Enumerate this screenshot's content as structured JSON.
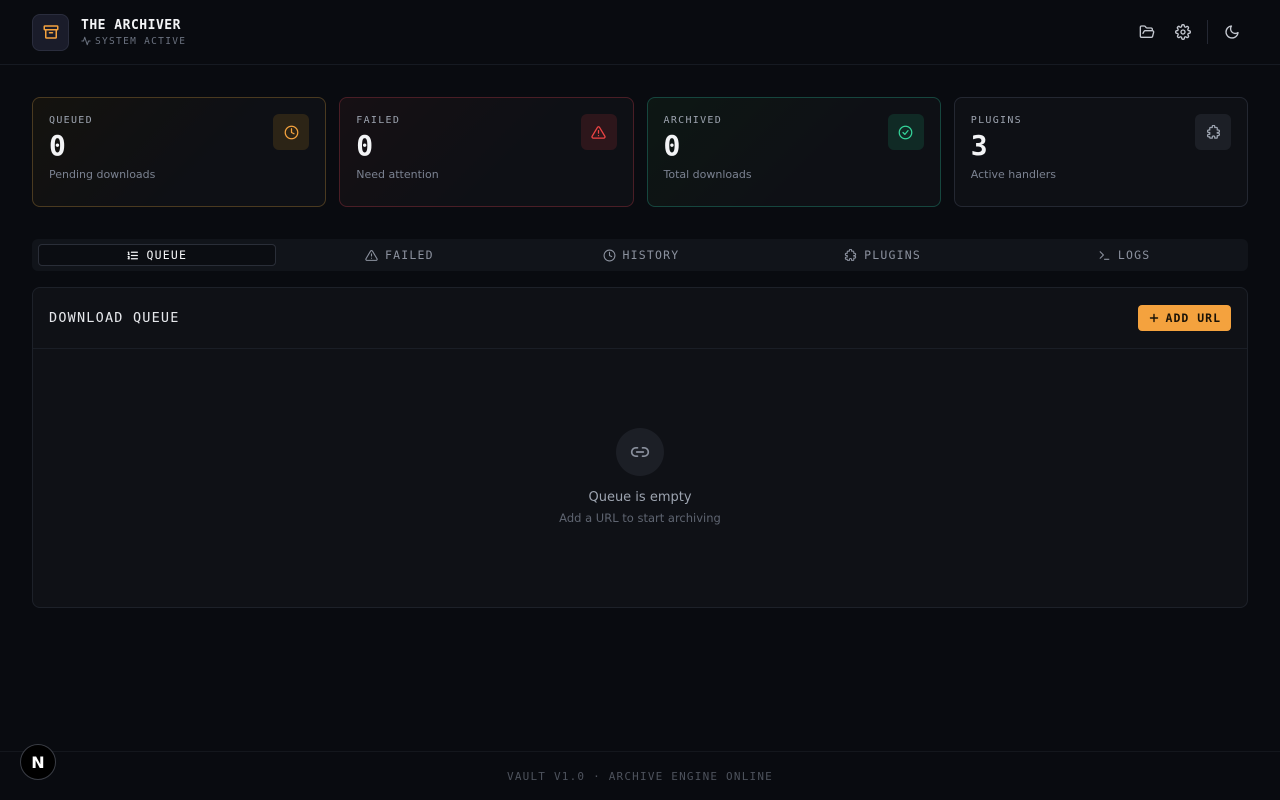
{
  "header": {
    "title": "THE ARCHIVER",
    "status": "SYSTEM ACTIVE",
    "actions": [
      "folder-open-icon",
      "gear-icon",
      "moon-icon"
    ]
  },
  "stats": [
    {
      "label": "QUEUED",
      "value": "0",
      "sub": "Pending downloads",
      "icon": "clock-icon",
      "color": "#f4a23e"
    },
    {
      "label": "FAILED",
      "value": "0",
      "sub": "Need attention",
      "icon": "warning-icon",
      "color": "#ef4444"
    },
    {
      "label": "ARCHIVED",
      "value": "0",
      "sub": "Total downloads",
      "icon": "check-circle-icon",
      "color": "#34d399"
    },
    {
      "label": "PLUGINS",
      "value": "3",
      "sub": "Active handlers",
      "icon": "puzzle-icon",
      "color": "#9ca3af"
    }
  ],
  "tabs": [
    {
      "label": "QUEUE",
      "active": true
    },
    {
      "label": "FAILED",
      "active": false
    },
    {
      "label": "HISTORY",
      "active": false
    },
    {
      "label": "PLUGINS",
      "active": false
    },
    {
      "label": "LOGS",
      "active": false
    }
  ],
  "panel": {
    "title": "DOWNLOAD QUEUE",
    "add_label": "ADD URL",
    "empty_title": "Queue is empty",
    "empty_sub": "Add a URL to start archiving"
  },
  "footer": {
    "text": "VAULT V1.0 · ARCHIVE ENGINE ONLINE",
    "badge": "N"
  },
  "colors": {
    "accent": "#f4a23e",
    "danger": "#ef4444",
    "success": "#34d399",
    "background": "#090b10"
  }
}
